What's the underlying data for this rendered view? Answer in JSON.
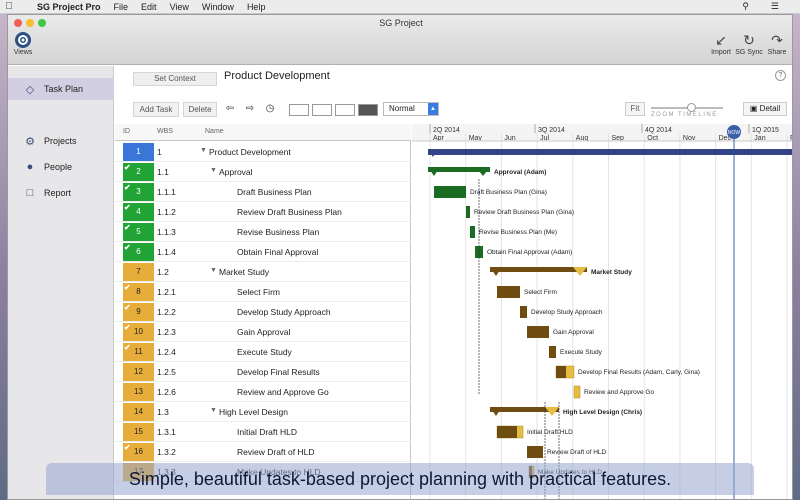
{
  "menubar": {
    "app": "SG Project Pro",
    "menus": [
      "File",
      "Edit",
      "View",
      "Window",
      "Help"
    ]
  },
  "window": {
    "title": "SG Project"
  },
  "toolbar": {
    "views_label": "Views",
    "import_label": "Import",
    "sync_label": "SG Sync",
    "share_label": "Share"
  },
  "sidebar": {
    "items": [
      {
        "label": "Task Plan",
        "icon": "diamond-icon",
        "active": true
      },
      {
        "label": "Projects",
        "icon": "gear-icon"
      },
      {
        "label": "People",
        "icon": "person-icon"
      },
      {
        "label": "Report",
        "icon": "document-icon"
      }
    ]
  },
  "content": {
    "set_context": "Set Context",
    "project_title": "Product Development",
    "help": "?",
    "add_task": "Add Task",
    "delete": "Delete",
    "view_select": "Normal",
    "fit": "Fit",
    "zoom_label": "ZOOM TIMELINE",
    "detail": "Detail"
  },
  "columns": {
    "id": "ID",
    "wbs": "WBS",
    "name": "Name"
  },
  "timeline": {
    "quarters": [
      "2Q 2014",
      "3Q 2014",
      "4Q 2014",
      "1Q 2015"
    ],
    "months": [
      "Apr",
      "May",
      "Jun",
      "Jul",
      "Aug",
      "Sep",
      "Oct",
      "Nov",
      "Dec",
      "Jan",
      "Feb"
    ],
    "now_label": "NOW"
  },
  "colors": {
    "done": "#22a336",
    "done_bar": "#1b6b22",
    "progress": "#e6ad3a",
    "progress_bar": "#6f4c12",
    "summary_bar": "#33448a",
    "root": "#3a75d8"
  },
  "tasks": [
    {
      "id": "1",
      "wbs": "1",
      "name": "Product Development",
      "level": 0,
      "summary": true,
      "status": "root",
      "done": false
    },
    {
      "id": "2",
      "wbs": "1.1",
      "name": "Approval",
      "level": 1,
      "summary": true,
      "status": "done",
      "done": true,
      "bar_label": "Approval (Adam)"
    },
    {
      "id": "3",
      "wbs": "1.1.1",
      "name": "Draft Business Plan",
      "level": 2,
      "status": "done",
      "done": true,
      "bar_label": "Draft Business Plan (Gina)"
    },
    {
      "id": "4",
      "wbs": "1.1.2",
      "name": "Review Draft Business Plan",
      "level": 2,
      "status": "done",
      "done": true,
      "bar_label": "Review Draft Business Plan (Gina)"
    },
    {
      "id": "5",
      "wbs": "1.1.3",
      "name": "Revise Business Plan",
      "level": 2,
      "status": "done",
      "done": true,
      "bar_label": "Revise Business Plan (Me)"
    },
    {
      "id": "6",
      "wbs": "1.1.4",
      "name": "Obtain Final Approval",
      "level": 2,
      "status": "done",
      "done": true,
      "bar_label": "Obtain Final Approval (Adam)"
    },
    {
      "id": "7",
      "wbs": "1.2",
      "name": "Market Study",
      "level": 1,
      "summary": true,
      "status": "progress",
      "done": false,
      "bar_label": "Market Study"
    },
    {
      "id": "8",
      "wbs": "1.2.1",
      "name": "Select Firm",
      "level": 2,
      "status": "progress",
      "done": true,
      "bar_label": "Select Firm"
    },
    {
      "id": "9",
      "wbs": "1.2.2",
      "name": "Develop Study Approach",
      "level": 2,
      "status": "progress",
      "done": true,
      "bar_label": "Develop Study Approach"
    },
    {
      "id": "10",
      "wbs": "1.2.3",
      "name": "Gain Approval",
      "level": 2,
      "status": "progress",
      "done": true,
      "bar_label": "Gain Approval"
    },
    {
      "id": "11",
      "wbs": "1.2.4",
      "name": "Execute Study",
      "level": 2,
      "status": "progress",
      "done": true,
      "bar_label": "Execute Study"
    },
    {
      "id": "12",
      "wbs": "1.2.5",
      "name": "Develop Final Results",
      "level": 2,
      "status": "progress",
      "done": false,
      "bar_label": "Develop Final Results (Adam, Carly, Gina)"
    },
    {
      "id": "13",
      "wbs": "1.2.6",
      "name": "Review and Approve Go",
      "level": 2,
      "status": "progress",
      "done": false,
      "bar_label": "Review and Approve Go"
    },
    {
      "id": "14",
      "wbs": "1.3",
      "name": "High Level Design",
      "level": 1,
      "summary": true,
      "status": "progress",
      "done": false,
      "bar_label": "High Level Design (Chris)"
    },
    {
      "id": "15",
      "wbs": "1.3.1",
      "name": "Initial Draft HLD",
      "level": 2,
      "status": "progress",
      "done": false,
      "bar_label": "Initial Draft HLD"
    },
    {
      "id": "16",
      "wbs": "1.3.2",
      "name": "Review Draft of HLD",
      "level": 2,
      "status": "progress",
      "done": true,
      "bar_label": "Review Draft of HLD"
    },
    {
      "id": "17",
      "wbs": "1.3.3",
      "name": "Make Updates to HLD",
      "level": 2,
      "status": "progress",
      "done": false,
      "bar_label": "Make Updates to HLD"
    }
  ],
  "caption": "Simple, beautiful task-based project planning with practical features."
}
